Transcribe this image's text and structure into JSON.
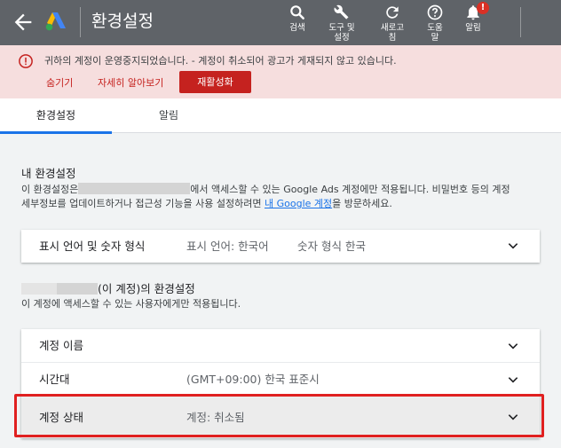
{
  "appbar": {
    "title": "환경설정",
    "tools": {
      "search": "검색",
      "tools": [
        "도구 및",
        "설정"
      ],
      "refresh": [
        "새로고",
        "침"
      ],
      "help": [
        "도움",
        "말"
      ],
      "notifications": "알림",
      "notification_badge": "!"
    }
  },
  "alert": {
    "message": "귀하의 계정이 운영중지되었습니다. - 계정이 취소되어 광고가 게재되지 않고 있습니다.",
    "hide": "숨기기",
    "learn_more": "자세히 알아보기",
    "reactivate": "재활성화"
  },
  "tabs": [
    {
      "label": "환경설정",
      "active": true
    },
    {
      "label": "알림",
      "active": false
    }
  ],
  "my_settings": {
    "title": "내 환경설정",
    "desc_line1_prefix": "이 환경설정은",
    "desc_line1_suffix": "에서 액세스할 수 있는 Google Ads 계정에만 적용됩니다. 비밀번호 등의 계정",
    "desc_line2_prefix": "세부정보를 업데이트하거나 접근성 기능을 사용 설정하려면 ",
    "desc_link": "내 Google 계정",
    "desc_line2_suffix": "을 방문하세요.",
    "row": {
      "label": "표시 언어 및 숫자 형식",
      "language": "표시 언어: 한국어",
      "number_format": "숫자 형식 한국"
    }
  },
  "account_settings": {
    "title_suffix": "(이 계정)의 환경설정",
    "desc": "이 계정에 액세스할 수 있는 사용자에게만 적용됩니다.",
    "rows": [
      {
        "label": "계정 이름",
        "value": ""
      },
      {
        "label": "시간대",
        "value": "(GMT+09:00) 한국 표준시"
      },
      {
        "label": "계정 상태",
        "value": "계정: 취소됨"
      }
    ]
  },
  "colors": {
    "appbar": "#5f6368",
    "alert_bg": "#f6dede",
    "alert_accent": "#c5221f",
    "tab_active": "#1a73e8",
    "highlight": "#e02020"
  }
}
